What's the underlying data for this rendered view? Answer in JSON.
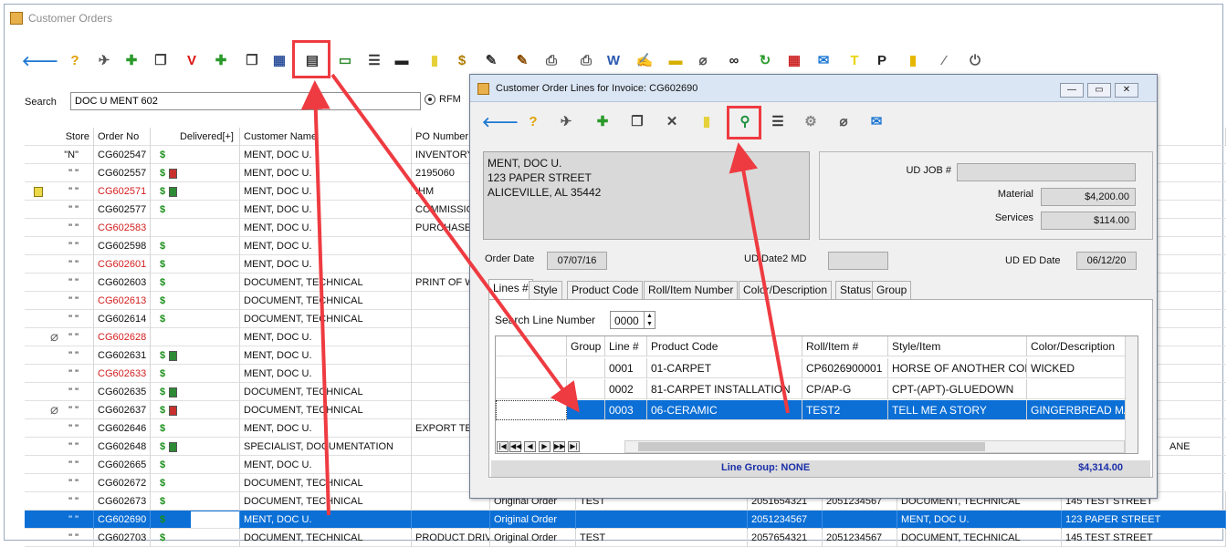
{
  "main": {
    "title": "Customer Orders",
    "search": {
      "label": "Search",
      "value": "DOC U MENT 602",
      "radio_label": "RFM"
    },
    "toolbar_icons": [
      "back-arrow-icon",
      "help-icon",
      "tools-icon",
      "add-order-icon",
      "copy-order-icon",
      "void-icon",
      "add-line-icon",
      "documents-icon",
      "batch-icon",
      "invoice-lines-icon",
      "cash-icon",
      "report-icon",
      "credit-card-icon",
      "note-icon",
      "statement-icon",
      "edit-icon",
      "edit2-icon",
      "preview-icon",
      "print-icon",
      "word-icon",
      "signature-icon",
      "ticket-icon",
      "paperclip-icon",
      "binoculars-icon",
      "refresh-icon",
      "calendar-icon",
      "email-icon",
      "t-icon",
      "p-icon",
      "notebook-icon",
      "pen-icon",
      "exit-icon"
    ],
    "columns": [
      "Store",
      "Order No",
      "Delivered[+]",
      "Customer Name",
      "PO Number",
      "",
      "",
      "",
      "",
      "",
      "",
      ""
    ],
    "rows": [
      {
        "store": "\"N\"",
        "order": "CG602547",
        "red": false,
        "dollar": true,
        "books": [],
        "name": "MENT, DOC U.",
        "po": "INVENTORY",
        "note": false,
        "clip": false
      },
      {
        "store": "\" \"",
        "order": "CG602557",
        "red": false,
        "dollar": true,
        "books": [
          "r"
        ],
        "name": "MENT, DOC U.",
        "po": "2195060",
        "note": false,
        "clip": false
      },
      {
        "store": "\" \"",
        "order": "CG602571",
        "red": true,
        "dollar": true,
        "books": [
          "g"
        ],
        "name": "MENT, DOC U.",
        "po": "IHM",
        "note": true,
        "clip": false
      },
      {
        "store": "\" \"",
        "order": "CG602577",
        "red": false,
        "dollar": true,
        "books": [],
        "name": "MENT, DOC U.",
        "po": "COMMISSIO",
        "note": false,
        "clip": false
      },
      {
        "store": "\" \"",
        "order": "CG602583",
        "red": true,
        "dollar": false,
        "books": [],
        "name": "MENT, DOC U.",
        "po": "PURCHASE C",
        "note": false,
        "clip": false
      },
      {
        "store": "\" \"",
        "order": "CG602598",
        "red": false,
        "dollar": true,
        "books": [],
        "name": "MENT, DOC U.",
        "po": "",
        "note": false,
        "clip": false
      },
      {
        "store": "\" \"",
        "order": "CG602601",
        "red": true,
        "dollar": true,
        "books": [],
        "name": "MENT, DOC U.",
        "po": "",
        "note": false,
        "clip": false
      },
      {
        "store": "\" \"",
        "order": "CG602603",
        "red": false,
        "dollar": true,
        "books": [],
        "name": "DOCUMENT, TECHNICAL",
        "po": "PRINT OF W",
        "note": false,
        "clip": false
      },
      {
        "store": "\" \"",
        "order": "CG602613",
        "red": true,
        "dollar": true,
        "books": [],
        "name": "DOCUMENT, TECHNICAL",
        "po": "",
        "note": false,
        "clip": false
      },
      {
        "store": "\" \"",
        "order": "CG602614",
        "red": false,
        "dollar": true,
        "books": [],
        "name": "DOCUMENT, TECHNICAL",
        "po": "",
        "note": false,
        "clip": false
      },
      {
        "store": "\" \"",
        "order": "CG602628",
        "red": true,
        "dollar": false,
        "books": [],
        "name": "MENT, DOC U.",
        "po": "",
        "note": false,
        "clip": true
      },
      {
        "store": "\" \"",
        "order": "CG602631",
        "red": false,
        "dollar": true,
        "books": [
          "g"
        ],
        "name": "MENT, DOC U.",
        "po": "",
        "note": false,
        "clip": false
      },
      {
        "store": "\" \"",
        "order": "CG602633",
        "red": true,
        "dollar": true,
        "books": [],
        "name": "MENT, DOC U.",
        "po": "",
        "note": false,
        "clip": false
      },
      {
        "store": "\" \"",
        "order": "CG602635",
        "red": false,
        "dollar": true,
        "books": [
          "g"
        ],
        "name": "DOCUMENT, TECHNICAL",
        "po": "",
        "note": false,
        "clip": false
      },
      {
        "store": "\" \"",
        "order": "CG602637",
        "red": false,
        "dollar": true,
        "books": [
          "r"
        ],
        "name": "DOCUMENT, TECHNICAL",
        "po": "",
        "note": false,
        "clip": true
      },
      {
        "store": "\" \"",
        "order": "CG602646",
        "red": false,
        "dollar": true,
        "books": [],
        "name": "MENT, DOC U.",
        "po": "EXPORT TES",
        "note": false,
        "clip": false
      },
      {
        "store": "\" \"",
        "order": "CG602648",
        "red": false,
        "dollar": true,
        "books": [
          "g"
        ],
        "name": "SPECIALIST, DOCUMENTATION",
        "po": "",
        "note": false,
        "clip": false
      },
      {
        "store": "\" \"",
        "order": "CG602665",
        "red": false,
        "dollar": true,
        "books": [],
        "name": "MENT, DOC U.",
        "po": "",
        "note": false,
        "clip": false
      },
      {
        "store": "\" \"",
        "order": "CG602672",
        "red": false,
        "dollar": true,
        "books": [],
        "name": "DOCUMENT, TECHNICAL",
        "po": "",
        "note": false,
        "clip": false
      },
      {
        "store": "\" \"",
        "order": "CG602673",
        "red": false,
        "dollar": true,
        "books": [],
        "name": "DOCUMENT, TECHNICAL",
        "po": "",
        "note": false,
        "clip": false
      },
      {
        "store": "\" \"",
        "order": "CG602690",
        "red": false,
        "dollar": true,
        "books": [],
        "name": "MENT, DOC U.",
        "po": "",
        "note": false,
        "clip": false
      },
      {
        "store": "\" \"",
        "order": "CG602703",
        "red": false,
        "dollar": true,
        "books": [],
        "name": "DOCUMENT, TECHNICAL",
        "po": "PRODUCT DRIVE",
        "note": false,
        "clip": false
      }
    ],
    "right_fragments": [
      {
        "row": 16,
        "text": "ANE"
      },
      {
        "row": 19,
        "type": "Original Order",
        "ref": "TEST",
        "p1": "2051654321",
        "p2": "2051234567",
        "cust": "DOCUMENT, TECHNICAL",
        "addr": "145 TEST STREET"
      },
      {
        "row": 20,
        "type": "Original Order",
        "ref": "",
        "p1": "2051234567",
        "p2": "",
        "cust": "MENT, DOC U.",
        "addr": "123 PAPER STREET"
      },
      {
        "row": 21,
        "type": "Original Order",
        "ref": "TEST",
        "p1": "2057654321",
        "p2": "2051234567",
        "cust": "DOCUMENT, TECHNICAL",
        "addr": "145 TEST STREET"
      }
    ],
    "selected_row": 20
  },
  "dialog": {
    "title": "Customer Order Lines for Invoice: CG602690",
    "window_buttons": [
      "—",
      "▭",
      "✕"
    ],
    "toolbar_icons": [
      "back-arrow-icon",
      "help-icon",
      "tools-icon",
      "add-line-icon",
      "copy-line-icon",
      "delete-line-icon",
      "note-icon",
      "magnifier-icon",
      "report-icon",
      "gear-icon",
      "paperclip-icon",
      "email-icon"
    ],
    "address": [
      "MENT, DOC U.",
      "123 PAPER STREET",
      "ALICEVILLE, AL  35442"
    ],
    "ud_job_label": "UD JOB #",
    "ud_job_value": "",
    "material_label": "Material",
    "material_value": "$4,200.00",
    "services_label": "Services",
    "services_value": "$114.00",
    "order_date_label": "Order Date",
    "order_date_value": "07/07/16",
    "ud_date2_label": "UD Date2 MD",
    "ud_date2_value": "",
    "ud_ed_label": "UD ED Date",
    "ud_ed_value": "06/12/20",
    "tabs": [
      "Lines #",
      "Style",
      "Product Code",
      "Roll/Item Number",
      "Color/Description",
      "Status",
      "Group"
    ],
    "search_line_label": "Search Line Number",
    "search_line_value": "0000",
    "line_columns": [
      "",
      "Group",
      "Line #",
      "Product Code",
      "Roll/Item #",
      "Style/Item",
      "Color/Description"
    ],
    "lines": [
      {
        "group": "",
        "line": "0001",
        "product": "01-CARPET",
        "roll": "CP6026900001",
        "style": "HORSE OF ANOTHER COLOR",
        "color": "WICKED"
      },
      {
        "group": "",
        "line": "0002",
        "product": "81-CARPET INSTALLATION",
        "roll": "CP/AP-G",
        "style": "CPT-(APT)-GLUEDOWN",
        "color": ""
      },
      {
        "group": "",
        "line": "0003",
        "product": "06-CERAMIC",
        "roll": "TEST2",
        "style": "TELL ME A STORY",
        "color": "GINGERBREAD MAN"
      }
    ],
    "selected_line": 2,
    "nav_buttons": [
      "|◀",
      "◀◀",
      "◀",
      "▶",
      "▶▶",
      "▶|"
    ],
    "line_group_text": "Line Group: NONE",
    "total_text": "$4,314.00"
  },
  "colors": {
    "highlight": "#ee3b41",
    "selection": "#0b6fd6",
    "dollar": "#1a8f1a",
    "red_order": "#d31e1e"
  }
}
